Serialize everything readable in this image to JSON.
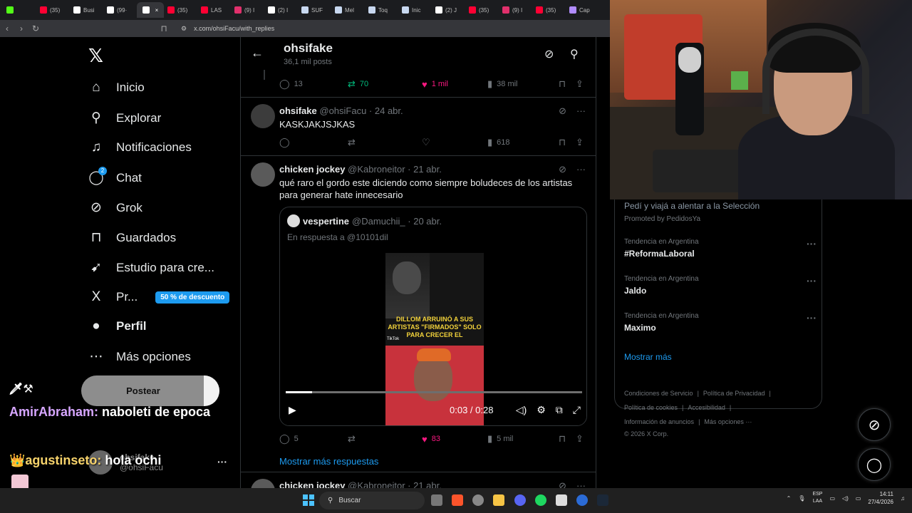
{
  "browser": {
    "tabs": [
      {
        "label": "",
        "color": "#53fc18"
      },
      {
        "label": "(35)",
        "color": "#ff0033"
      },
      {
        "label": "Busi",
        "color": "#ffffff"
      },
      {
        "label": "(99·",
        "color": "#ffffff"
      },
      {
        "label": "",
        "color": "#ffffff",
        "active": true
      },
      {
        "label": "(35)",
        "color": "#ff0033"
      },
      {
        "label": "LAS",
        "color": "#ff0033"
      },
      {
        "label": "(9) I",
        "color": "#e1306c"
      },
      {
        "label": "(2) I",
        "color": "#ffffff"
      },
      {
        "label": "SUF",
        "color": "#c8d8f0"
      },
      {
        "label": "Mel",
        "color": "#c8d8f0"
      },
      {
        "label": "Toq",
        "color": "#c8d8f0"
      },
      {
        "label": "Inic",
        "color": "#c8d8f0"
      },
      {
        "label": "(2) J",
        "color": "#ffffff"
      },
      {
        "label": "(35)",
        "color": "#ff0033"
      },
      {
        "label": "(9) I",
        "color": "#e1306c"
      },
      {
        "label": "(35)",
        "color": "#ff0033"
      },
      {
        "label": "Cap",
        "color": "#b18cff"
      }
    ],
    "url": "x.com/ohsiFacu/with_replies"
  },
  "sidebar": {
    "nav": [
      {
        "label": "Inicio",
        "icon": "home-icon",
        "glyph": "⌂"
      },
      {
        "label": "Explorar",
        "icon": "search-icon",
        "glyph": "⚲"
      },
      {
        "label": "Notificaciones",
        "icon": "bell-icon",
        "glyph": "♫"
      },
      {
        "label": "Chat",
        "icon": "chat-icon",
        "glyph": "◯"
      },
      {
        "label": "Grok",
        "icon": "grok-icon",
        "glyph": "⊘"
      },
      {
        "label": "Guardados",
        "icon": "bookmark-icon",
        "glyph": "⊓"
      },
      {
        "label": "Estudio para cre...",
        "icon": "rocket-icon",
        "glyph": "➹"
      },
      {
        "label": "Pr...",
        "icon": "x-premium-icon",
        "glyph": "X"
      },
      {
        "label": "Perfil",
        "icon": "person-icon",
        "glyph": "●"
      },
      {
        "label": "Más opciones",
        "icon": "more-circle-icon",
        "glyph": "⋯"
      }
    ],
    "chat_badge": "2",
    "promo": "50 % de descuento",
    "post_button": "Postear",
    "profile_name": "ohsifake",
    "profile_handle": "@ohsiFacu"
  },
  "stream_chat": {
    "emotes": "🗡⚒",
    "msg1_user": "AmirAbraham:",
    "msg1_text": " naboleti de epoca",
    "msg2_user": "👑agustinseto:",
    "msg2_text": " hola ochi"
  },
  "header": {
    "title": "ohsifake",
    "subtitle": "36,1 mil posts"
  },
  "top_actions": {
    "replies": "13",
    "reposts": "70",
    "likes": "1 mil",
    "views": "38 mil"
  },
  "tweet1": {
    "name": "ohsifake",
    "meta": "@ohsiFacu · 24 abr.",
    "text": "KASKJAKJSJKAS",
    "views": "618"
  },
  "tweet2": {
    "name": "chicken jockey",
    "meta": "@Kabroneitor · 21 abr.",
    "text": "qué raro el gordo este diciendo como siempre boludeces de los artistas para generar hate innecesario",
    "replies": "5",
    "likes": "83",
    "views": "5 mil"
  },
  "quote": {
    "name": "vespertine",
    "meta": "@Damuchii_ · 20 abr.",
    "reply_to": "En respuesta a @10101dil",
    "video_caption": "DILLOM ARRUINÓ A SUS ARTISTAS \"FIRMADOS\" SOLO PARA CRECER EL",
    "video_watermark": "TikTok",
    "time": "0:03 / 0:28",
    "progress": 0.09
  },
  "show_more_replies": "Mostrar más respuestas",
  "tweet3": {
    "name": "chicken jockey",
    "meta": "@Kabroneitor · 21 abr."
  },
  "right": {
    "promoted_title": "Pedí y viajá a alentar a la Selección",
    "promoted_sub": "Promoted by PedidosYa",
    "trends": [
      {
        "category": "Tendencia en Argentina",
        "name": "#ReformaLaboral"
      },
      {
        "category": "Tendencia en Argentina",
        "name": "Jaldo"
      },
      {
        "category": "Tendencia en Argentina",
        "name": "Maximo"
      }
    ],
    "show_more": "Mostrar más",
    "footer": {
      "l1": "Condiciones de Servicio",
      "l2": "Política de Privacidad",
      "l3": "Política de cookies",
      "l4": "Accesibilidad",
      "l5": "Información de anuncios",
      "l6": "Más opciones ···",
      "copyright": "© 2026 X Corp."
    }
  },
  "taskbar": {
    "search": "Buscar",
    "lang": "ESP",
    "lang2": "LAA",
    "time": "14:11",
    "date": "27/4/2026"
  }
}
